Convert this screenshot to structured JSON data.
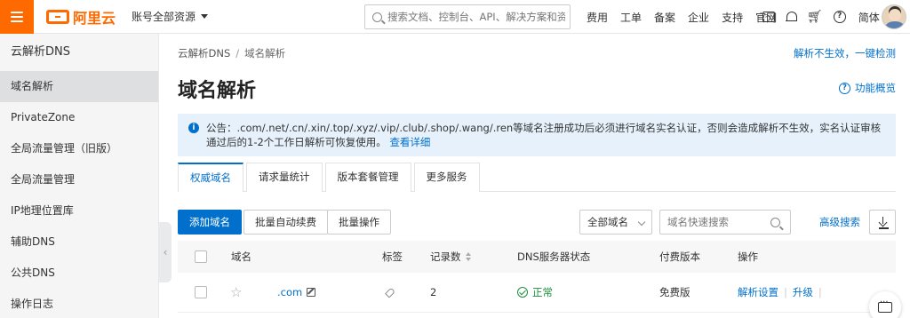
{
  "topbar": {
    "logo_text": "阿里云",
    "account": "账号全部资源",
    "search_placeholder": "搜索文档、控制台、API、解决方案和资源",
    "links": [
      "费用",
      "工单",
      "备案",
      "企业",
      "支持",
      "官网"
    ],
    "language": "简体",
    "brand_color": "#ff6a00"
  },
  "sidebar": {
    "title": "云解析DNS",
    "items": [
      {
        "label": "域名解析",
        "active": true
      },
      {
        "label": "PrivateZone",
        "active": false
      },
      {
        "label": "全局流量管理（旧版）",
        "active": false
      },
      {
        "label": "全局流量管理",
        "active": false
      },
      {
        "label": "IP地理位置库",
        "active": false
      },
      {
        "label": "辅助DNS",
        "active": false
      },
      {
        "label": "公共DNS",
        "active": false
      },
      {
        "label": "操作日志",
        "active": false
      }
    ]
  },
  "main": {
    "breadcrumb": [
      "云解析DNS",
      "域名解析"
    ],
    "breadcrumb_sep": "/",
    "quick_check": "解析不生效，一键检测",
    "title": "域名解析",
    "overview": "功能概览",
    "notice": {
      "text": "公告：.com/.net/.cn/.xin/.top/.xyz/.vip/.club/.shop/.wang/.ren等域名注册成功后必须进行域名实名认证，否则会造成解析不生效，实名认证审核通过后的1-2个工作日解析可恢复使用。",
      "link": "查看详细"
    },
    "tabs": [
      "权威域名",
      "请求量统计",
      "版本套餐管理",
      "更多服务"
    ],
    "toolbar": {
      "add": "添加域名",
      "batch_renew": "批量自动续费",
      "batch_ops": "批量操作",
      "filter": "全部域名",
      "search_placeholder": "域名快速搜索",
      "advanced": "高级搜索"
    },
    "table": {
      "headers": {
        "domain": "域名",
        "tag": "标签",
        "records": "记录数",
        "dns_status": "DNS服务器状态",
        "edition": "付费版本",
        "actions": "操作"
      },
      "rows": [
        {
          "domain": ".com",
          "records": "2",
          "status": "正常",
          "edition": "免费版",
          "action_settings": "解析设置",
          "action_upgrade": "升级"
        }
      ]
    }
  },
  "colors": {
    "accent": "#0070cc",
    "ok": "#1e8e3e"
  }
}
